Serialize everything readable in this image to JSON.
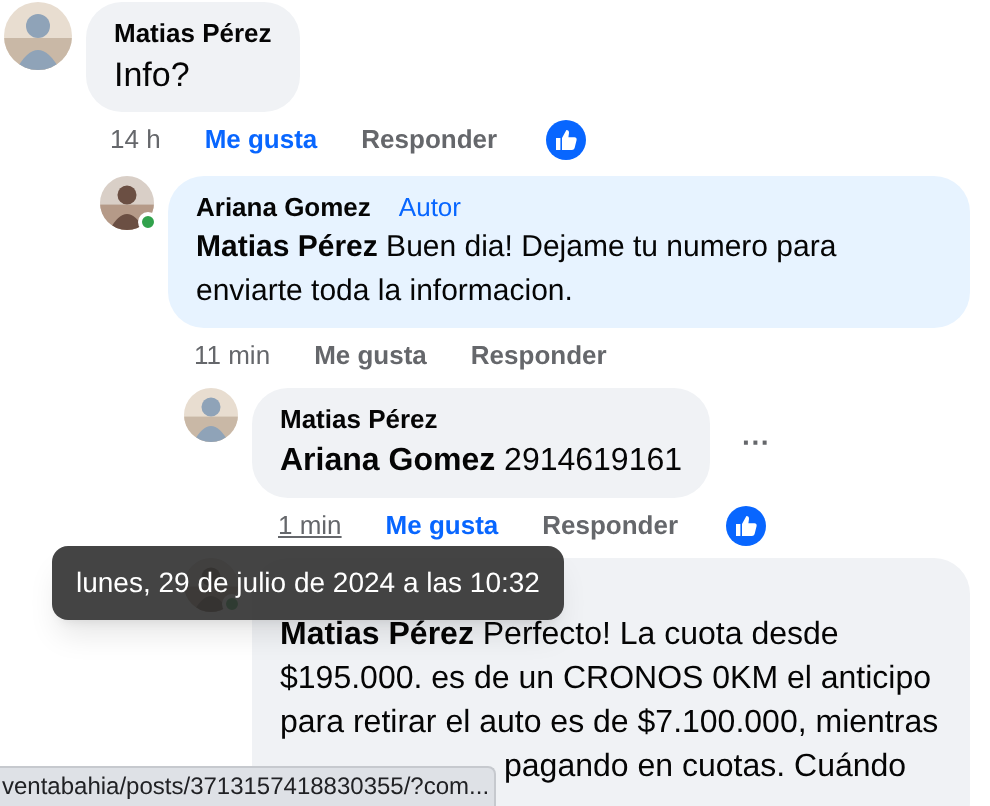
{
  "comments": [
    {
      "author": "Matias Pérez",
      "online": false,
      "text": "Info?",
      "time": "14 h",
      "time_hovered": false,
      "like": "Me gusta",
      "liked": true,
      "reply": "Responder",
      "reaction": true,
      "children": [
        {
          "author": "Ariana Gomez",
          "author_badge": "Autor",
          "online": true,
          "mention": "Matias Pérez",
          "text": "Buen dia! Dejame tu numero para enviarte toda la informacion.",
          "time": "11 min",
          "time_hovered": false,
          "like": "Me gusta",
          "liked": false,
          "reply": "Responder",
          "reaction": false,
          "children": [
            {
              "author": "Matias Pérez",
              "online": false,
              "mention": "Ariana Gomez",
              "text": "2914619161",
              "more": "···",
              "time": "1 min",
              "time_hovered": true,
              "time_tooltip": "lunes, 29 de julio de 2024 a las 10:32",
              "like": "Me gusta",
              "liked": true,
              "reply": "Responder",
              "reaction": true
            },
            {
              "online": true,
              "mention": "Matias Pérez",
              "text": "Perfecto! La cuota desde $195.000. es de un CRONOS 0KM el anticipo para retirar el auto es de $7.100.000, mientras",
              "text_partial_line": "pagando en cuotas. Cuándo"
            }
          ]
        }
      ]
    }
  ],
  "status_bar": "ventabahia/posts/3713157418830355/?com..."
}
